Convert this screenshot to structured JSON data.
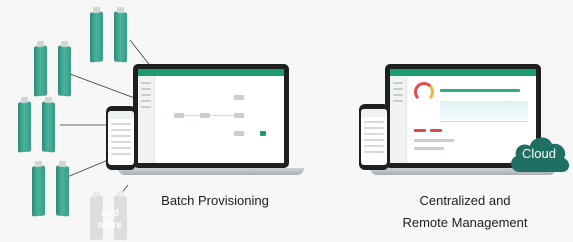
{
  "captions": {
    "left": "Batch Provisioning",
    "right_line1": "Centralized and",
    "right_line2": "Remote Management"
  },
  "more_label_line1": "and",
  "more_label_line2": "more",
  "cloud_label": "Cloud",
  "colors": {
    "accent_green": "#1d9c6f",
    "device_teal": "#3a9c86",
    "cloud_teal": "#1f6f63",
    "text": "#202124"
  },
  "icons": [
    "access-point-icon",
    "laptop-icon",
    "phone-icon",
    "cloud-icon"
  ]
}
